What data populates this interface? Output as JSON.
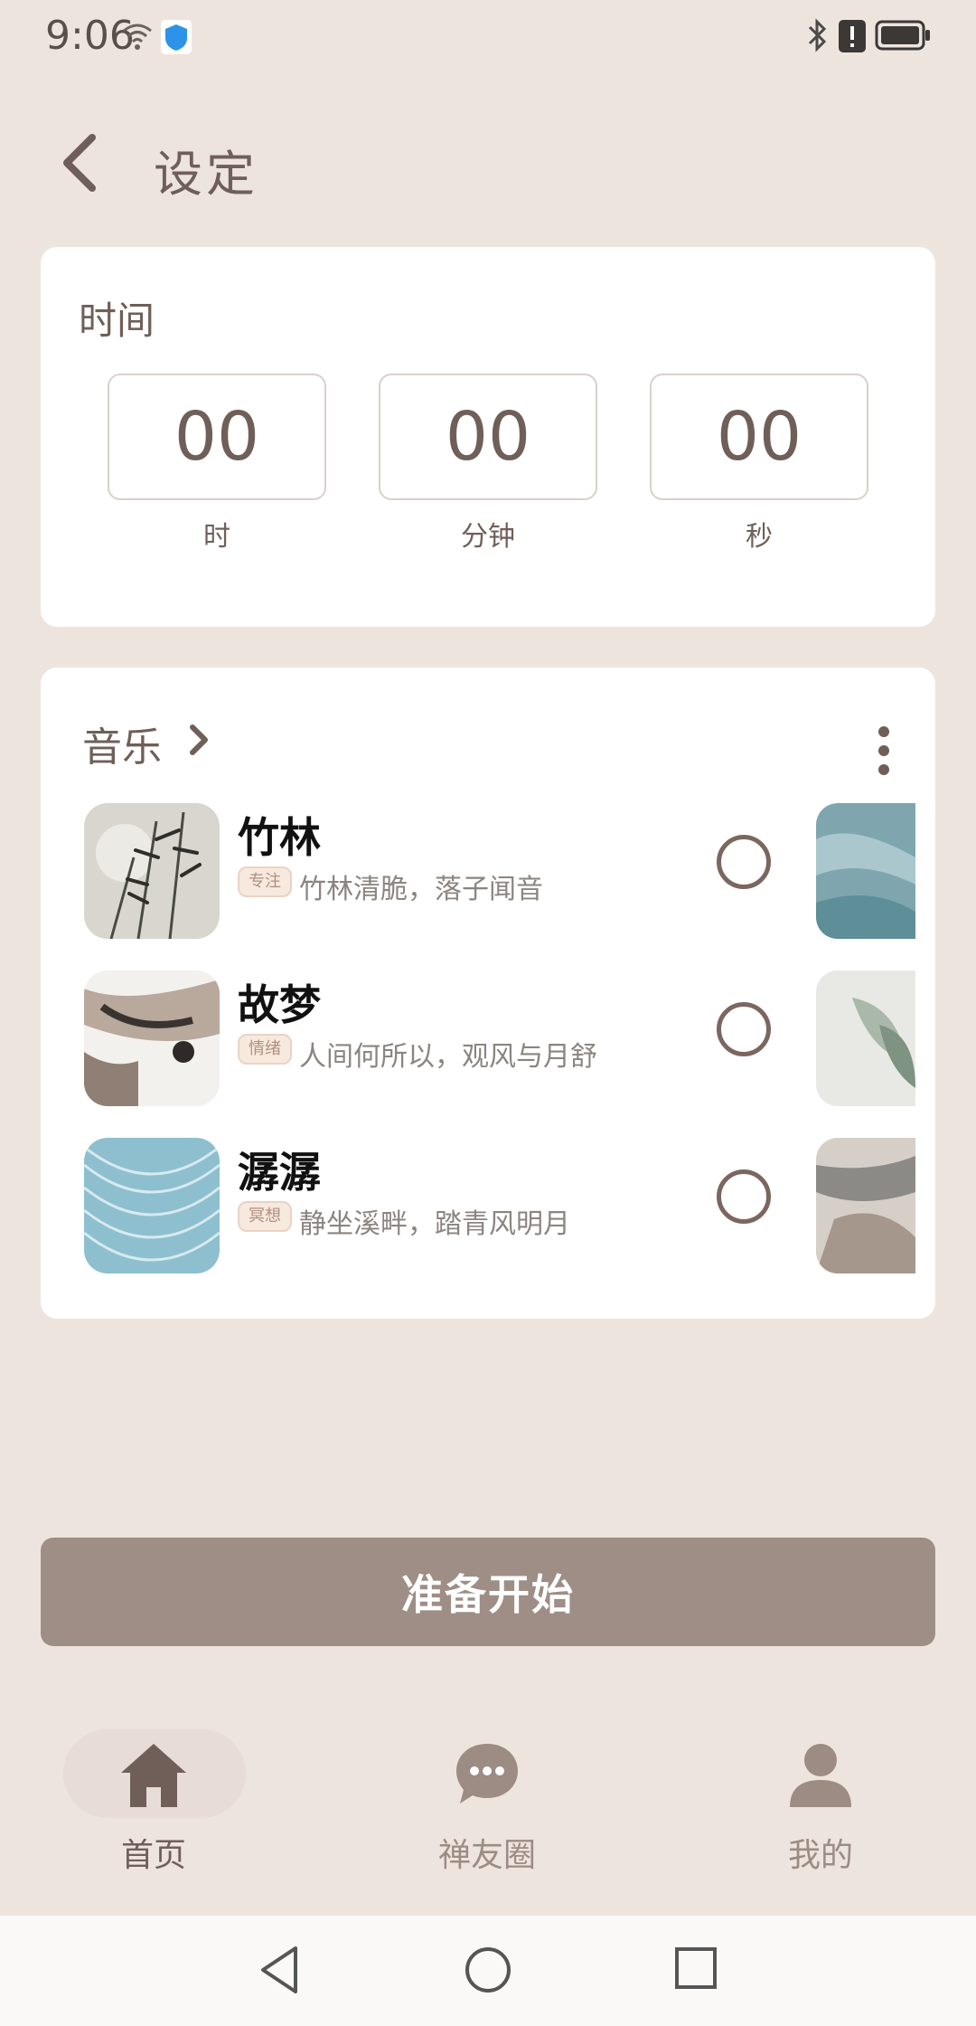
{
  "status_bar": {
    "time": "9:06"
  },
  "header": {
    "title": "设定"
  },
  "time_card": {
    "title": "时间",
    "fields": [
      {
        "value": "00",
        "unit": "时"
      },
      {
        "value": "00",
        "unit": "分钟"
      },
      {
        "value": "00",
        "unit": "秒"
      }
    ]
  },
  "music_card": {
    "title": "音乐",
    "tracks": [
      {
        "name": "竹林",
        "tag": "专注",
        "desc": "竹林清脆，落子闻音"
      },
      {
        "name": "故梦",
        "tag": "情绪",
        "desc": "人间何所以，观风与月舒"
      },
      {
        "name": "潺潺",
        "tag": "冥想",
        "desc": "静坐溪畔，踏青风明月"
      }
    ]
  },
  "start_button": {
    "label": "准备开始"
  },
  "bottom_nav": {
    "items": [
      {
        "label": "首页"
      },
      {
        "label": "禅友圈"
      },
      {
        "label": "我的"
      }
    ]
  },
  "colors": {
    "background": "#EEE4DE",
    "primary_text": "#6F5F58",
    "button": "#9E8E86",
    "card": "#FFFFFF"
  }
}
